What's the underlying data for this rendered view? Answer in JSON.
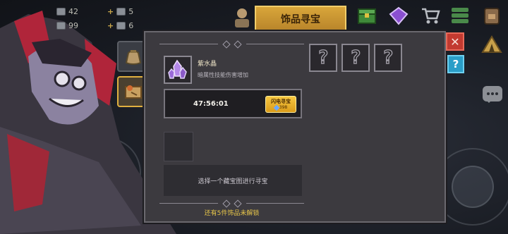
{
  "hud": {
    "stat_a_value": "42",
    "stat_b_value": "99",
    "bonus_a": "5",
    "bonus_b": "6",
    "plus_sign": "+"
  },
  "header": {
    "active_tab_label": "饰品寻宝"
  },
  "item": {
    "name": "紫水晶",
    "description": "暗属性技能伤害增加"
  },
  "timer": {
    "countdown": "47:56:01",
    "flash_button_label": "闪电寻宝",
    "flash_cost": "398"
  },
  "select_prompt": "选择一个藏宝图进行寻宝",
  "unlock_message": "还有5件饰品未解锁",
  "locked_slots": [
    {
      "label": "?"
    },
    {
      "label": "?"
    },
    {
      "label": "?"
    }
  ],
  "buttons": {
    "close_label": "✕",
    "help_label": "?"
  },
  "colors": {
    "accent_gold": "#d8a63a",
    "close_red": "#c23a30",
    "help_blue": "#2a9ec8",
    "unlock_text": "#e8c64a"
  }
}
